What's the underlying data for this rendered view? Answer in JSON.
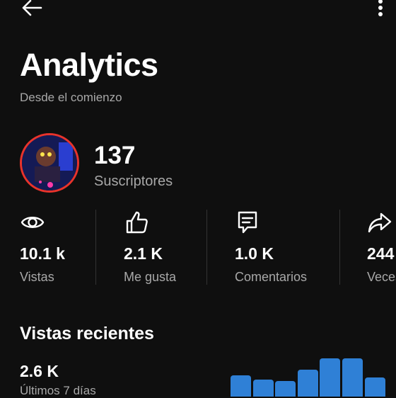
{
  "header": {
    "back_icon": "arrow-left-icon",
    "more_icon": "more-vertical-icon"
  },
  "title": "Analytics",
  "subtitle": "Desde el comienzo",
  "channel": {
    "subscriber_count": "137",
    "subscriber_label": "Suscriptores"
  },
  "stats": [
    {
      "icon": "eye-icon",
      "value": "10.1 k",
      "label": "Vistas"
    },
    {
      "icon": "thumbs-up-icon",
      "value": "2.1 K",
      "label": "Me gusta"
    },
    {
      "icon": "comment-icon",
      "value": "1.0 K",
      "label": "Comentarios"
    },
    {
      "icon": "share-icon",
      "value": "244",
      "label": "Veces"
    }
  ],
  "recent": {
    "title": "Vistas recientes",
    "value": "2.6 K",
    "period": "Últimos 7 días",
    "bar_color": "#2f80d6",
    "bars": [
      0.55,
      0.45,
      0.4,
      0.7,
      1.0,
      1.0,
      0.5
    ]
  },
  "colors": {
    "background": "#0f0f0f",
    "accent": "#2f80d6",
    "avatar_ring": "#e8332b",
    "muted_text": "#a8a8a8"
  }
}
